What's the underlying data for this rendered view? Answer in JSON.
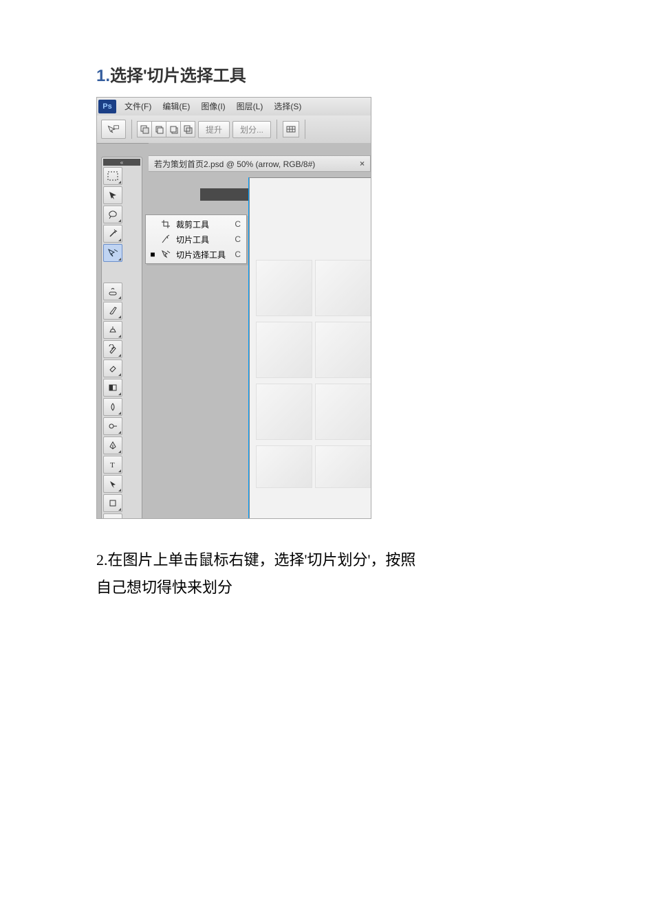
{
  "step1": {
    "number": "1.",
    "text": "选择'切片选择工具"
  },
  "step2": {
    "line1": "2.在图片上单击鼠标右键，选择'切片划分'，按照",
    "line2": "自己想切得快来划分"
  },
  "photoshop": {
    "logo": "Ps",
    "menubar": [
      "文件(F)",
      "编辑(E)",
      "图像(I)",
      "图层(L)",
      "选择(S)"
    ],
    "optionsbar": {
      "lift": "提升",
      "divide": "划分..."
    },
    "document_tab": {
      "title": "若为策划首页2.psd @ 50% (arrow, RGB/8#)",
      "close": "×"
    },
    "flyout": {
      "items": [
        {
          "marker": "",
          "label": "裁剪工具",
          "shortcut": "C"
        },
        {
          "marker": "",
          "label": "切片工具",
          "shortcut": "C"
        },
        {
          "marker": "■",
          "label": "切片选择工具",
          "shortcut": "C"
        }
      ]
    },
    "collapse_glyph": "«"
  }
}
